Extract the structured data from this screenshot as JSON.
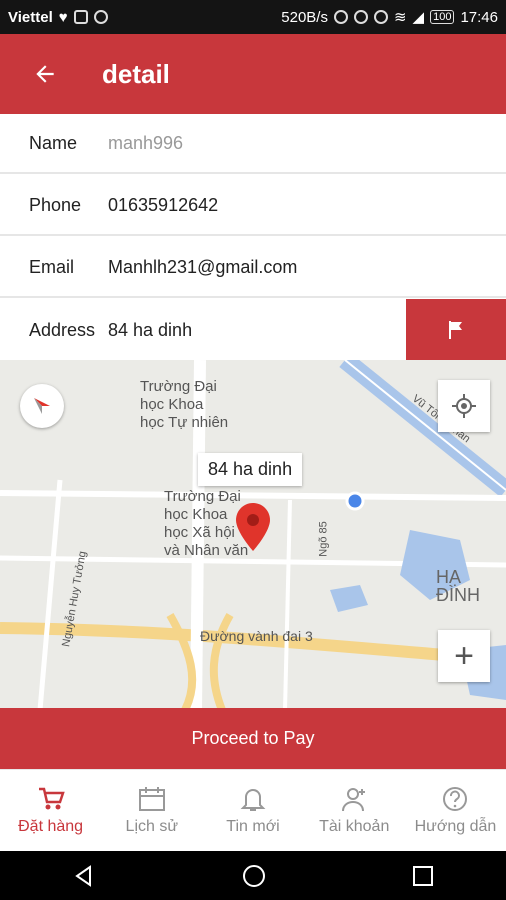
{
  "status": {
    "carrier": "Viettel",
    "speed": "520B/s",
    "battery": "100",
    "time": "17:46"
  },
  "header": {
    "back_icon": "arrow-left-icon",
    "title": "detail"
  },
  "form": {
    "name": {
      "label": "Name",
      "value": "manh996"
    },
    "phone": {
      "label": "Phone",
      "value": "01635912642"
    },
    "email": {
      "label": "Email",
      "value": "Manhlh231@gmail.com"
    },
    "address": {
      "label": "Address",
      "value": "84 ha dinh",
      "button_icon": "flag-icon"
    }
  },
  "map": {
    "marker_label": "84 ha dinh",
    "labels": {
      "poi1": "Trường Đại\nhọc Khoa\nhọc Tự nhiên",
      "poi2": "Trường Đại\nhọc Khoa\nhọc Xã hội\nvà Nhân văn",
      "road_ring": "Đường vành đai 3",
      "district": "HẠ ĐÌNH",
      "street_nguyen": "Nguyễn Huy Tưởng",
      "street_ngo": "Ngõ 85",
      "street_vu": "Vũ Tông Phan"
    },
    "controls": {
      "zoom_in": "+"
    }
  },
  "actions": {
    "proceed": "Proceed to Pay"
  },
  "tabs": [
    {
      "label": "Đặt hàng",
      "icon": "cart-icon",
      "active": true
    },
    {
      "label": "Lịch sử",
      "icon": "calendar-icon",
      "active": false
    },
    {
      "label": "Tin mới",
      "icon": "bell-icon",
      "active": false
    },
    {
      "label": "Tài khoản",
      "icon": "user-icon",
      "active": false
    },
    {
      "label": "Hướng dẫn",
      "icon": "help-icon",
      "active": false
    }
  ],
  "colors": {
    "primary": "#c8373c",
    "inactive": "#8c8c8c"
  }
}
